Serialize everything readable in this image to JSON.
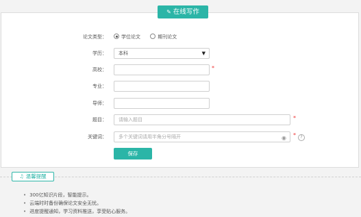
{
  "header": {
    "title": "在线写作"
  },
  "form": {
    "paper_type": {
      "label": "论文类型：",
      "options": [
        "学位论文",
        "期刊论文"
      ],
      "selected": "学位论文"
    },
    "degree": {
      "label": "学历：",
      "value": "本科"
    },
    "school": {
      "label": "高校：",
      "value": ""
    },
    "major": {
      "label": "专业：",
      "value": ""
    },
    "advisor": {
      "label": "导师：",
      "value": ""
    },
    "title": {
      "label": "题目：",
      "placeholder": "请输入题目"
    },
    "keywords": {
      "label": "关键词：",
      "placeholder": "多个关键词请用半角分号隔开"
    },
    "required_mark": "*",
    "help_mark": "?",
    "save_label": "保存"
  },
  "tips": {
    "title": "温馨提醒",
    "items": [
      "300亿知识片段，智能提示。",
      "云端时时备份确保论文安全无忧。",
      "进度提醒通知，学习资料推送，享受贴心服务。"
    ]
  },
  "colors": {
    "accent": "#2bb5a7",
    "required": "#ee3333"
  },
  "icons": {
    "header": "pencil-icon",
    "tips": "bell-icon",
    "keywords": "eye-icon"
  }
}
